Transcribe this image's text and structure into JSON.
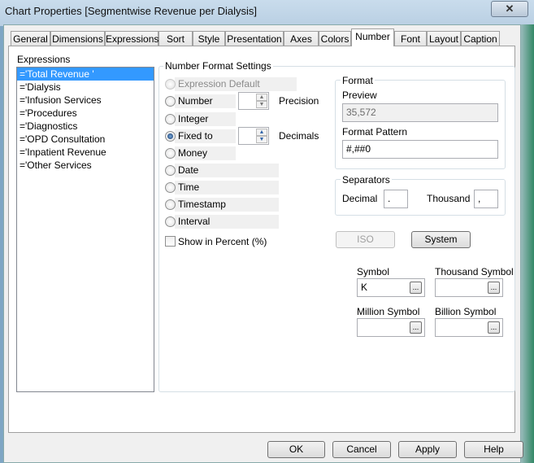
{
  "window": {
    "title": "Chart Properties [Segmentwise Revenue per Dialysis]",
    "close_icon": "close-icon"
  },
  "tabs": [
    "General",
    "Dimensions",
    "Expressions",
    "Sort",
    "Style",
    "Presentation",
    "Axes",
    "Colors",
    "Number",
    "Font",
    "Layout",
    "Caption"
  ],
  "active_tab": "Number",
  "expressions": {
    "label": "Expressions",
    "items": [
      "='Total Revenue '",
      "='Dialysis",
      "='Infusion Services",
      "='Procedures",
      "='Diagnostics",
      "='OPD Consultation",
      "='Inpatient Revenue",
      "='Other Services"
    ],
    "selected": 0
  },
  "number_format": {
    "label": "Number Format Settings",
    "options": [
      "Expression Default",
      "Number",
      "Integer",
      "Fixed to",
      "Money",
      "Date",
      "Time",
      "Timestamp",
      "Interval"
    ],
    "selected": "Fixed to",
    "precision_label": "Precision",
    "precision_value": "",
    "decimals_label": "Decimals",
    "decimals_value": "",
    "show_percent_label": "Show in Percent (%)",
    "show_percent_checked": false
  },
  "format": {
    "label": "Format",
    "preview_label": "Preview",
    "preview_value": "35,572",
    "pattern_label": "Format Pattern",
    "pattern_value": "#,##0"
  },
  "separators": {
    "label": "Separators",
    "decimal_label": "Decimal",
    "decimal_value": ".",
    "thousand_label": "Thousand",
    "thousand_value": ","
  },
  "buttons": {
    "iso": "ISO",
    "system": "System",
    "ok": "OK",
    "cancel": "Cancel",
    "apply": "Apply",
    "help": "Help",
    "ellipsis": "..."
  },
  "symbols": {
    "symbol_label": "Symbol",
    "symbol_value": "K",
    "thousand_label": "Thousand Symbol",
    "thousand_value": "",
    "million_label": "Million Symbol",
    "million_value": "",
    "billion_label": "Billion Symbol",
    "billion_value": ""
  },
  "colors": {
    "selection": "#3399ff",
    "dialog_bg": "#f0f0f0"
  }
}
